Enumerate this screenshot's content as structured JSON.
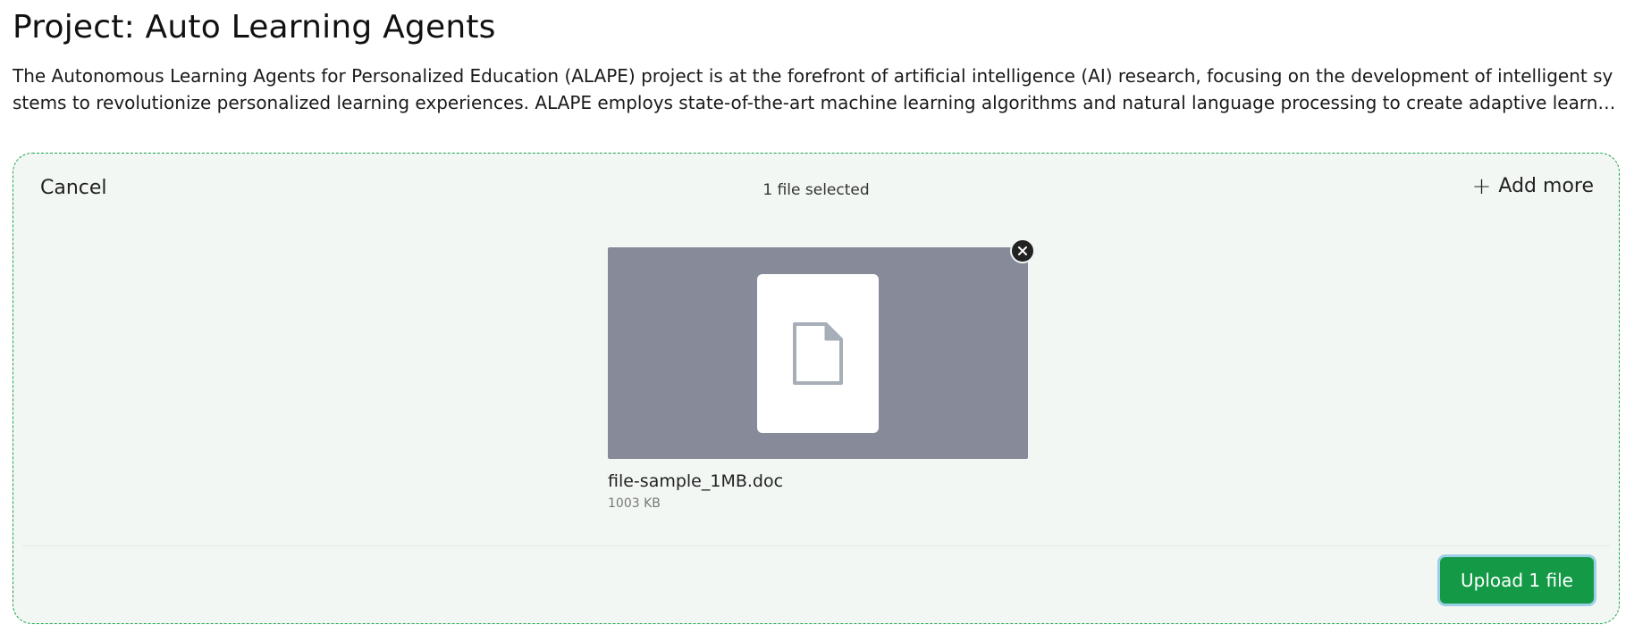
{
  "project": {
    "title": "Project: Auto Learning Agents",
    "description": "The Autonomous Learning Agents for Personalized Education (ALAPE) project is at the forefront of artificial intelligence (AI) research, focusing on the development of intelligent systems to revolutionize personalized learning experiences. ALAPE employs state-of-the-art machine learning algorithms and natural language processing to create adaptive learn…"
  },
  "uploader": {
    "cancel_label": "Cancel",
    "status": "1 file selected",
    "add_more_label": "Add more",
    "upload_label": "Upload 1 file",
    "files": [
      {
        "name": "file-sample_1MB.doc",
        "size": "1003 KB",
        "icon": "document-icon"
      }
    ]
  },
  "colors": {
    "accent": "#149a47",
    "dashboard_border": "#17a34a",
    "dashboard_background": "#f3f7f4",
    "preview_background": "#868a99"
  }
}
